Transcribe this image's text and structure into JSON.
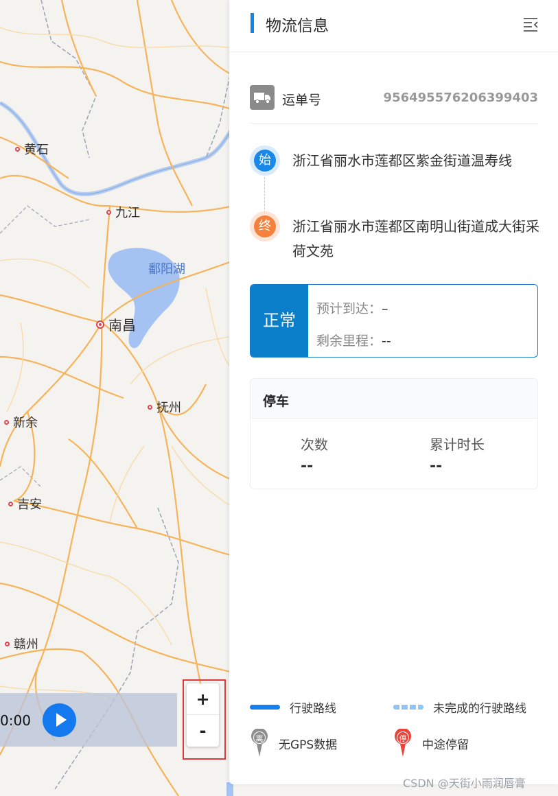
{
  "map": {
    "cities": [
      {
        "id": "huangshi",
        "name": "黄石"
      },
      {
        "id": "jiujiang",
        "name": "九江"
      },
      {
        "id": "nanchang",
        "name": "南昌"
      },
      {
        "id": "fuzhou",
        "name": "抚州"
      },
      {
        "id": "xinyu",
        "name": "新余"
      },
      {
        "id": "jian",
        "name": "吉安"
      },
      {
        "id": "ganzhou",
        "name": "赣州"
      }
    ],
    "lake_label": "鄱阳湖",
    "playback": {
      "time": "0:00"
    },
    "zoom": {
      "in_label": "+",
      "out_label": "-"
    }
  },
  "panel": {
    "title": "物流信息",
    "waybill": {
      "label": "运单号",
      "number": "956495576206399403"
    },
    "start": {
      "badge": "始",
      "address": "浙江省丽水市莲都区紫金街道温寿线"
    },
    "end": {
      "badge": "终",
      "address": "浙江省丽水市莲都区南明山街道成大街采荷文苑"
    },
    "status": {
      "badge": "正常",
      "eta_label": "预计到达：",
      "eta_value": "–",
      "remaining_label": "剩余里程：",
      "remaining_value": "--"
    },
    "parking": {
      "title": "停车",
      "count_label": "次数",
      "count_value": "--",
      "duration_label": "累计时长",
      "duration_value": "--"
    },
    "legend": {
      "driving": "行驶路线",
      "unfinished": "未完成的行驶路线",
      "no_gps_pin": "离",
      "no_gps": "无GPS数据",
      "stop_pin": "停",
      "stop": "中途停留"
    }
  },
  "watermark": "CSDN @天街小雨润唇膏",
  "colors": {
    "accent": "#1384ec",
    "status": "#0b7ec9",
    "start": "#1a88e8",
    "end": "#f5813c",
    "stop_pin": "#e8453c",
    "no_gps_pin": "#8e8e8e",
    "highlight": "#e0393e"
  }
}
